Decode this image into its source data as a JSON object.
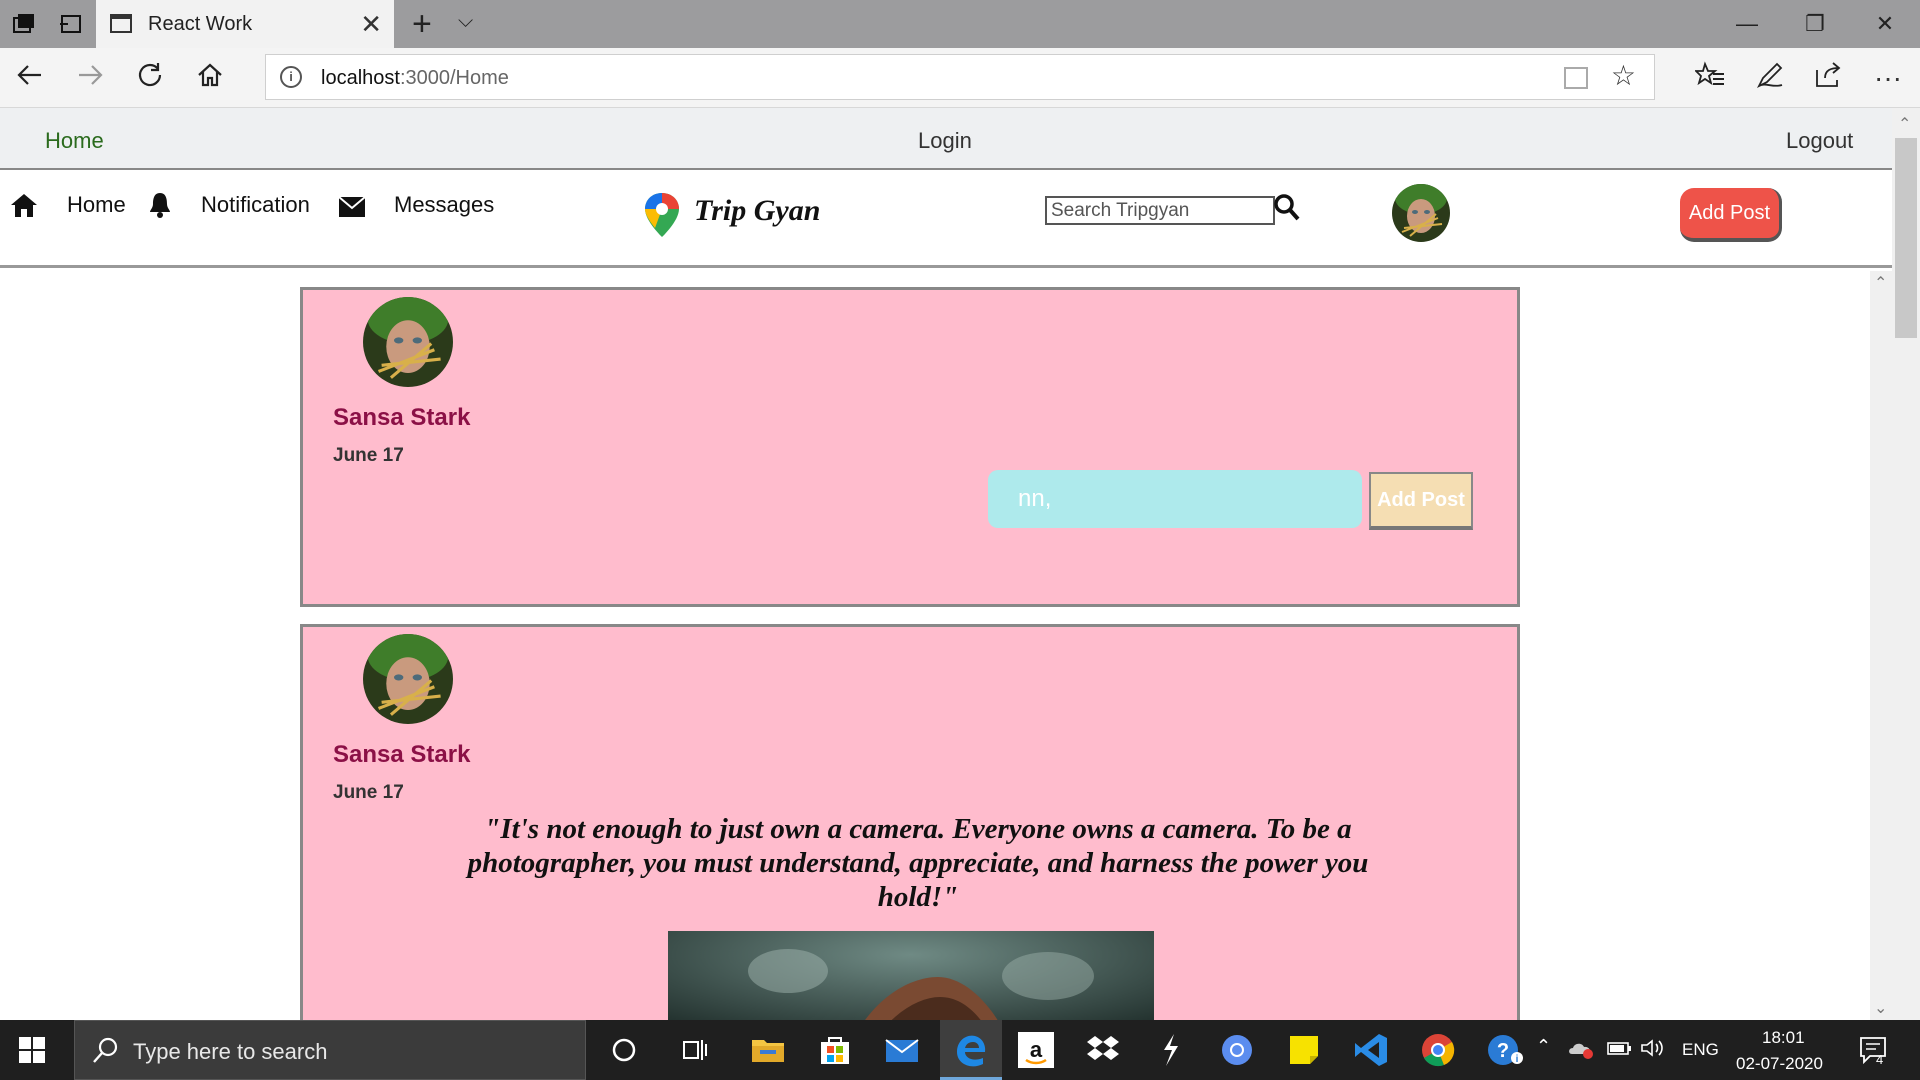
{
  "browser": {
    "tab_title": "React Work",
    "tab_close": "✕",
    "new_tab": "+",
    "tab_menu": "⌵",
    "window_controls": [
      "—",
      "❐",
      "✕"
    ],
    "url_host": "localhost",
    "url_path": ":3000/Home",
    "nav_icons": [
      "back-icon",
      "forward-icon",
      "refresh-icon",
      "home-icon"
    ],
    "toolbar_icons": [
      "favorites-icon",
      "pen-icon",
      "share-icon",
      "more-icon"
    ]
  },
  "topnav": {
    "home": "Home",
    "login": "Login",
    "logout": "Logout"
  },
  "header": {
    "home": "Home",
    "notification": "Notification",
    "messages": "Messages",
    "logo": "Trip Gyan",
    "search_placeholder": "Search Tripgyan",
    "add_post": "Add Post"
  },
  "posts": [
    {
      "author": "Sansa Stark",
      "date": "June 17",
      "comment_value": "nn,",
      "comment_button": "Add Post"
    },
    {
      "author": "Sansa Stark",
      "date": "June 17",
      "quote": "\"It's not enough to just own a camera. Everyone owns a camera. To be a photographer, you must understand, appreciate, and harness the power you hold!\""
    }
  ],
  "taskbar": {
    "search_placeholder": "Type here to search",
    "language": "ENG",
    "time": "18:01",
    "date": "02-07-2020",
    "notification_count": "4"
  },
  "colors": {
    "post_bg": "#ffbccd",
    "author": "#8b1046",
    "add_post_btn": "#ee5349",
    "comment_input": "#aeeaec",
    "comment_btn": "#f5deb3"
  }
}
